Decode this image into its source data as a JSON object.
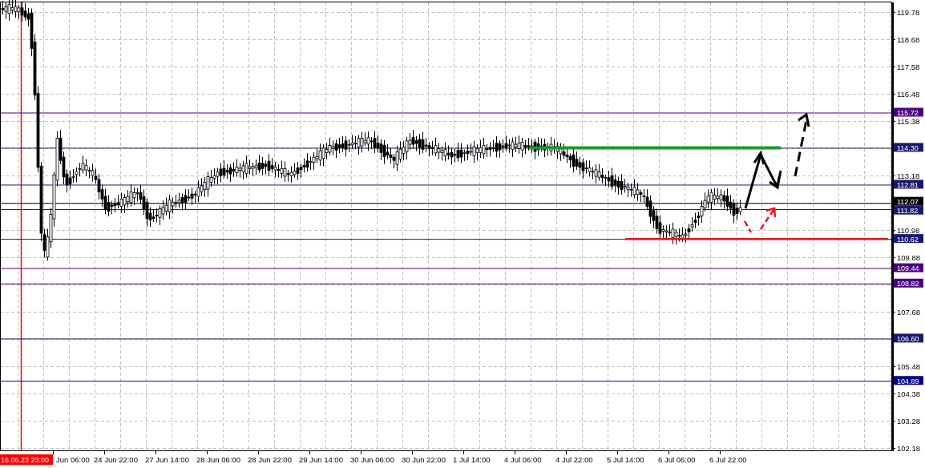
{
  "chart": {
    "marker_time": "16.06.23 23:00",
    "price_ticks": [
      "119.78",
      "118.68",
      "117.58",
      "116.48",
      "115.38",
      "113.18",
      "110.98",
      "109.88",
      "107.68",
      "105.48",
      "104.38",
      "103.28",
      "102.18"
    ],
    "levels": [
      {
        "label": "115.72",
        "color": "#4b0082"
      },
      {
        "label": "114.30",
        "color": "#191970"
      },
      {
        "label": "112.81",
        "color": "#191970"
      },
      {
        "label": "112.07",
        "color": "#000000"
      },
      {
        "label": "111.82",
        "color": "#191970"
      },
      {
        "label": "110.62",
        "color": "#191970"
      },
      {
        "label": "109.44",
        "color": "#4b0082"
      },
      {
        "label": "108.82",
        "color": "#4b0082"
      },
      {
        "label": "106.60",
        "color": "#191970"
      },
      {
        "label": "104.89",
        "color": "#00008b"
      }
    ],
    "time_labels": [
      "Jun 06:00",
      "24 Jun 22:00",
      "27 Jun 14:00",
      "28 Jun 06:00",
      "28 Jun 22:00",
      "29 Jun 14:00",
      "30 Jun 06:00",
      "30 Jun 22:00",
      "1 Jul 14:00",
      "4 Jul 06:00",
      "4 Jul 22:00",
      "5 Jul 14:00",
      "6 Jul 06:00",
      "6 Jul 22:00"
    ]
  }
}
